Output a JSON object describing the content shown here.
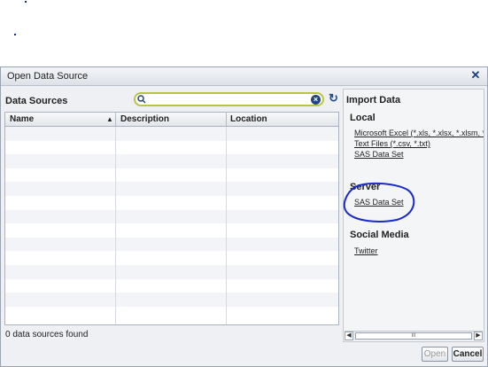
{
  "dialog": {
    "title": "Open Data Source"
  },
  "left": {
    "heading": "Data Sources",
    "search": {
      "value": "",
      "placeholder": ""
    },
    "columns": [
      "Name",
      "Description",
      "Location"
    ],
    "status": "0 data sources found"
  },
  "right": {
    "heading": "Import Data",
    "local": {
      "label": "Local",
      "items": [
        "Microsoft Excel (*.xls, *.xlsx, *.xlsm, *.xlsb",
        "Text Files (*.csv, *.txt)",
        "SAS Data Set"
      ]
    },
    "server": {
      "label": "Server",
      "items": [
        "SAS Data Set"
      ]
    },
    "social": {
      "label": "Social Media",
      "items": [
        "Twitter"
      ]
    },
    "scroll_grip": "III"
  },
  "buttons": {
    "open": "Open",
    "cancel": "Cancel"
  },
  "icons": [
    "close-icon",
    "search-icon",
    "clear-search-icon",
    "refresh-icon",
    "sort-ascending-icon"
  ],
  "colors": {
    "search_border": "#b9c444",
    "annotation": "#1a2acc"
  }
}
